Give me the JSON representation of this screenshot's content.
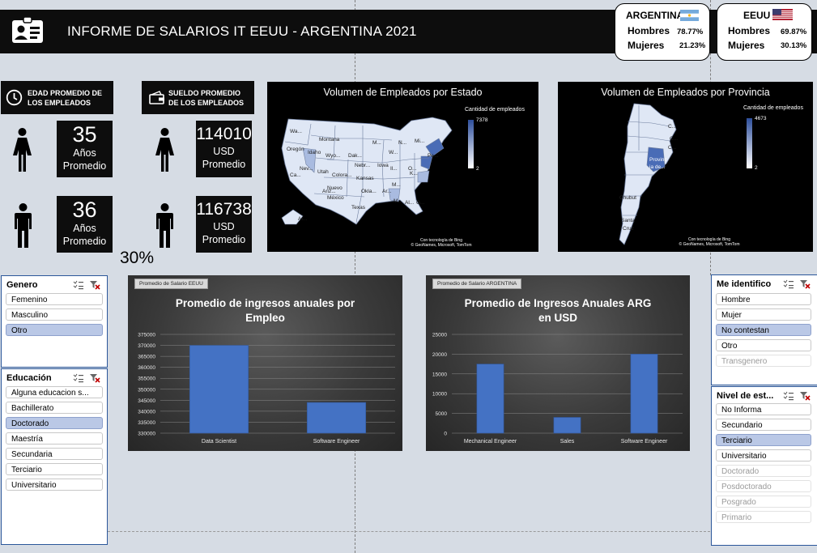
{
  "header": {
    "title": "INFORME DE SALARIOS IT EEUU - ARGENTINA 2021",
    "icon": "id-card-icon"
  },
  "argentina_card": {
    "title": "ARGENTINA",
    "rows": [
      {
        "label": "Hombres",
        "value": "78.77%"
      },
      {
        "label": "Mujeres",
        "value": "21.23%"
      }
    ]
  },
  "eeuu_card": {
    "title": "EEUU",
    "rows": [
      {
        "label": "Hombres",
        "value": "69.87%"
      },
      {
        "label": "Mujeres",
        "value": "30.13%"
      }
    ]
  },
  "age": {
    "label": "EDAD PROMEDIO DE LOS EMPLEADOS",
    "female": {
      "value": "35",
      "line1": "Años",
      "line2": "Promedio"
    },
    "male": {
      "value": "36",
      "line1": "Años",
      "line2": "Promedio"
    }
  },
  "salary": {
    "label": "SUELDO PROMEDIO DE LOS EMPLEADOS",
    "female": {
      "value": "114010",
      "line1": "USD",
      "line2": "Promedio"
    },
    "male": {
      "value": "116738",
      "line1": "USD",
      "line2": "Promedio"
    }
  },
  "percent_label": "30%",
  "map_usa": {
    "title": "Volumen de Empleados por Estado",
    "legend_title": "Cantidad de empleados",
    "legend_max": "7378",
    "legend_min": "2",
    "credit_1": "Con tecnología de Bing",
    "credit_2": "© GeoNames, Microsoft, TomTom",
    "labels": [
      "Wa...",
      "Montana",
      "M...",
      "N...",
      "Oregón",
      "Idaho",
      "Wyo...",
      "Dak...",
      "W...",
      "Mi...",
      "Nev...",
      "Utah",
      "Colora...",
      "Kansas",
      "Iowa",
      "Il...",
      "O...",
      "Pe...",
      "Ca...",
      "Nebr...",
      "M...",
      "K...",
      "Ariz...",
      "Nuevo",
      "México",
      "Okla...",
      "Ar...",
      "Texas",
      "M...",
      "Al...",
      "G...",
      "Al..."
    ],
    "colors": {
      "low": "#dfe7f5",
      "mid": "#a9bbe0",
      "high": "#4a6cb6",
      "background": "#000000"
    }
  },
  "map_arg": {
    "title": "Volumen de Empleados por Provincia",
    "legend_title": "Cantidad de empleados",
    "legend_max": "4673",
    "legend_min": "2",
    "credit_1": "Con tecnología de Bing",
    "credit_2": "© GeoNames, Microsoft, TomTom",
    "labels": [
      "C...",
      "C...",
      "C...",
      "Provinc",
      "ia de...",
      "Chubut",
      "Santa",
      "Cruz"
    ]
  },
  "chart_usa": {
    "tag": "Promedio de Salario EEUU",
    "title_line1": "Promedio de ingresos anuales por",
    "title_line2": "Empleo",
    "chart_data": {
      "type": "bar",
      "categories": [
        "Data Scientist",
        "Software Engineer"
      ],
      "values": [
        370000,
        344000
      ],
      "ylim": [
        330000,
        375000
      ],
      "yticks": [
        375000,
        370000,
        365000,
        360000,
        355000,
        350000,
        345000,
        340000,
        335000,
        330000
      ]
    }
  },
  "chart_arg": {
    "tag": "Promedio de Salario ARGENTINA",
    "title_line1": "Promedio de Ingresos Anuales ARG",
    "title_line2": "en USD",
    "chart_data": {
      "type": "bar",
      "categories": [
        "Mechanical Engineer",
        "Sales",
        "Software Engineer"
      ],
      "values": [
        17500,
        4000,
        20000
      ],
      "ylim": [
        0,
        25000
      ],
      "yticks": [
        25000,
        20000,
        15000,
        10000,
        5000,
        0
      ]
    }
  },
  "slicer_genero": {
    "title": "Genero",
    "items": [
      {
        "label": "Femenino",
        "state": "normal"
      },
      {
        "label": "Masculino",
        "state": "normal"
      },
      {
        "label": "Otro",
        "state": "selected"
      }
    ]
  },
  "slicer_educacion": {
    "title": "Educación",
    "items": [
      {
        "label": "Alguna educacion s...",
        "state": "normal"
      },
      {
        "label": "Bachillerato",
        "state": "normal"
      },
      {
        "label": "Doctorado",
        "state": "selected"
      },
      {
        "label": "Maestría",
        "state": "normal"
      },
      {
        "label": "Secundaria",
        "state": "normal"
      },
      {
        "label": "Terciario",
        "state": "normal"
      },
      {
        "label": "Universitario",
        "state": "normal"
      }
    ]
  },
  "slicer_identifico": {
    "title": "Me identifico",
    "items": [
      {
        "label": "Hombre",
        "state": "normal"
      },
      {
        "label": "Mujer",
        "state": "normal"
      },
      {
        "label": "No contestan",
        "state": "selected"
      },
      {
        "label": "Otro",
        "state": "normal"
      },
      {
        "label": "Transgenero",
        "state": "disabled"
      }
    ]
  },
  "slicer_nivel": {
    "title": "Nivel de est...",
    "items": [
      {
        "label": "No Informa",
        "state": "normal"
      },
      {
        "label": "Secundario",
        "state": "normal"
      },
      {
        "label": "Terciario",
        "state": "selected"
      },
      {
        "label": "Universitario",
        "state": "normal"
      },
      {
        "label": "Doctorado",
        "state": "disabled"
      },
      {
        "label": "Posdoctorado",
        "state": "disabled"
      },
      {
        "label": "Posgrado",
        "state": "disabled"
      },
      {
        "label": "Primario",
        "state": "disabled"
      }
    ]
  },
  "colors": {
    "bar_fill": "#4472c4",
    "slicer_selected": "#bac8e6",
    "slicer_border": "#2b579a",
    "panel_dark": "#0d0d0d"
  }
}
